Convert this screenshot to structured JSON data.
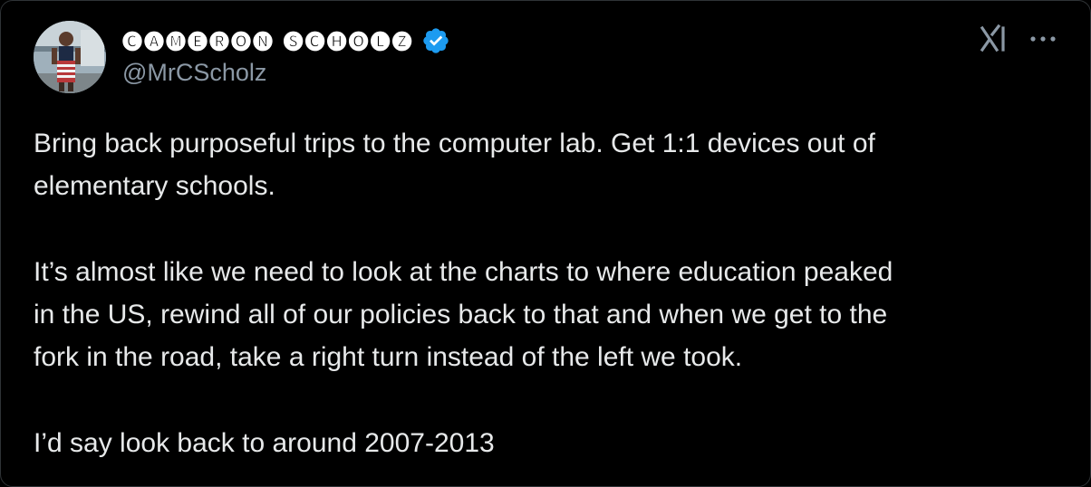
{
  "author": {
    "display_name": "🅒🅐🅜🅔🅡🅞🅝 🅢🅒🅗🅞🅛🅩",
    "handle": "@MrCScholz",
    "verified": true
  },
  "tweet": {
    "paragraphs": [
      [
        "Bring back purposeful trips to the computer lab. Get  1:1 devices out of",
        "elementary schools."
      ],
      [
        "It’s almost like we need to look at the charts to where education peaked",
        "in the US, rewind all of our policies back to that and when we get to the",
        "fork in the road, take a right turn instead of the left we took."
      ],
      [
        "I’d say look back to around 2007-2013"
      ]
    ]
  },
  "icons": {
    "grok": "grok-icon",
    "more": "more-options-icon",
    "verified": "verified-badge-icon"
  },
  "colors": {
    "background": "#000000",
    "text": "#e7e9ea",
    "secondary_text": "#8b98a5",
    "verified_blue": "#1d9bf0"
  }
}
